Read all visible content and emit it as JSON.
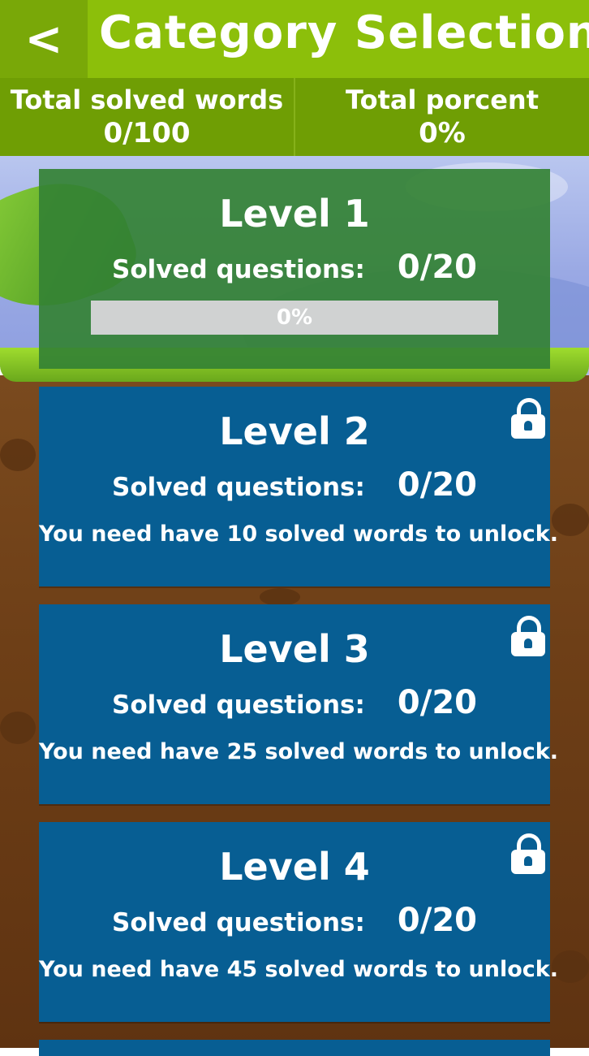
{
  "header": {
    "back_label": "<",
    "title": "Category Selection"
  },
  "stats": [
    {
      "label": "Total solved words",
      "value": "0/100"
    },
    {
      "label": "Total porcent",
      "value": "0%"
    }
  ],
  "levels": [
    {
      "name": "Level 1",
      "questions_label": "Solved questions:",
      "count": "0/20",
      "locked": false,
      "progress_text": "0%",
      "progress": 0
    },
    {
      "name": "Level 2",
      "questions_label": "Solved questions:",
      "count": "0/20",
      "locked": true,
      "requirement": "You need have 10 solved words to unlock."
    },
    {
      "name": "Level 3",
      "questions_label": "Solved questions:",
      "count": "0/20",
      "locked": true,
      "requirement": "You need have 25 solved words to unlock."
    },
    {
      "name": "Level 4",
      "questions_label": "Solved questions:",
      "count": "0/20",
      "locked": true,
      "requirement": "You need have 45 solved words to unlock."
    }
  ],
  "colors": {
    "header": "#8cbf0a",
    "stats_bar": "#6f9e04",
    "unlocked_card": "#348234",
    "locked_card": "#075e93"
  },
  "icons": {
    "lock": "lock-icon",
    "back": "back-arrow-icon"
  }
}
